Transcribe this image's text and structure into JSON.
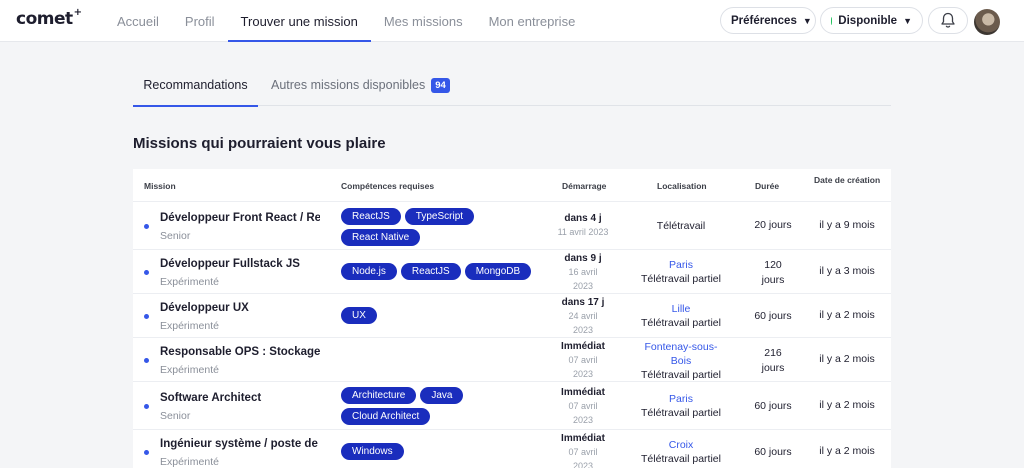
{
  "header": {
    "logo": "comet",
    "logo_mark": "+",
    "nav": [
      "Accueil",
      "Profil",
      "Trouver une mission",
      "Mes missions",
      "Mon entreprise"
    ],
    "active_nav": 2,
    "preferences": "Préférences",
    "availability": "Disponible",
    "availability_color": "#22c35e"
  },
  "tabs": {
    "recommendations": "Recommandations",
    "others": "Autres missions disponibles",
    "others_count": "94"
  },
  "section_title": "Missions qui pourraient vous plaire",
  "table": {
    "headers": {
      "mission": "Mission",
      "skills": "Compétences requises",
      "start": "Démarrage",
      "location": "Localisation",
      "duration": "Durée",
      "created": "Date de création"
    },
    "rows": [
      {
        "title": "Développeur Front React / React Native",
        "level": "Senior",
        "skills": [
          "ReactJS",
          "TypeScript",
          "React Native"
        ],
        "start": "dans 4 j",
        "start_date": "11 avril 2023",
        "city": "",
        "mode": "Télétravail",
        "duration": "20 jours",
        "created": "il y a 9 mois"
      },
      {
        "title": "Développeur Fullstack JS",
        "level": "Expérimenté",
        "skills": [
          "Node.js",
          "ReactJS",
          "MongoDB"
        ],
        "start": "dans 9 j",
        "start_date": "16 avril 2023",
        "city": "Paris",
        "mode": "Télétravail partiel",
        "duration": "120 jours",
        "created": "il y a 3 mois"
      },
      {
        "title": "Développeur UX",
        "level": "Expérimenté",
        "skills": [
          "UX"
        ],
        "start": "dans 17 j",
        "start_date": "24 avril 2023",
        "city": "Lille",
        "mode": "Télétravail partiel",
        "duration": "60 jours",
        "created": "il y a 2 mois"
      },
      {
        "title": "Responsable OPS : Stockage et sauvegarde",
        "level": "Expérimenté",
        "skills": [],
        "start": "Immédiat",
        "start_date": "07 avril 2023",
        "city": "Fontenay-sous-Bois",
        "mode": "Télétravail partiel",
        "duration": "216 jours",
        "created": "il y a 2 mois"
      },
      {
        "title": "Software Architect",
        "level": "Senior",
        "skills": [
          "Architecture",
          "Java",
          "Cloud Architect"
        ],
        "start": "Immédiat",
        "start_date": "07 avril 2023",
        "city": "Paris",
        "mode": "Télétravail partiel",
        "duration": "60 jours",
        "created": "il y a 2 mois"
      },
      {
        "title": "Ingénieur système / poste de travail",
        "level": "Expérimenté",
        "skills": [
          "Windows"
        ],
        "start": "Immédiat",
        "start_date": "07 avril 2023",
        "city": "Croix",
        "mode": "Télétravail partiel",
        "duration": "60 jours",
        "created": "il y a 2 mois"
      }
    ]
  },
  "icons": {
    "bell": "bell-icon",
    "chevron": "chevron-down-icon",
    "avatar": "avatar"
  }
}
